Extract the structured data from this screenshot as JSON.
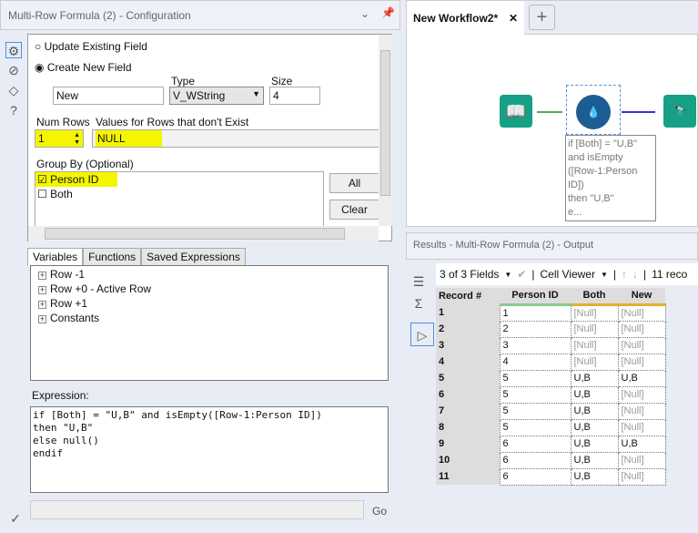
{
  "config": {
    "title": "Multi-Row Formula (2) - Configuration",
    "update_label": "Update Existing Field",
    "create_label": "Create New  Field",
    "type_label": "Type",
    "size_label": "Size",
    "field_name": "New",
    "type_value": "V_WString",
    "size_value": "4",
    "num_rows_label": "Num Rows",
    "num_rows_value": "1",
    "nonexist_label": "Values for Rows that don't Exist",
    "nonexist_value": "NULL",
    "group_label": "Group By (Optional)",
    "group_items": [
      {
        "label": "Person ID",
        "checked": true
      },
      {
        "label": "Both",
        "checked": false
      }
    ],
    "all_btn": "All",
    "clear_btn": "Clear",
    "tabs": [
      "Variables",
      "Functions",
      "Saved Expressions"
    ],
    "tree": [
      "Row -1",
      "Row +0 - Active Row",
      "Row +1",
      "Constants"
    ],
    "expression_label": "Expression:",
    "expression": "if [Both] = \"U,B\" and isEmpty([Row-1:Person ID])\nthen \"U,B\"\nelse null()\nendif",
    "go_label": "Go"
  },
  "workflow": {
    "tab": "New Workflow2*",
    "annotation": "if [Both] = \"U,B\"\nand isEmpty\n([Row-1:Person\nID])\nthen \"U,B\"\ne..."
  },
  "results": {
    "title": "Results - Multi-Row Formula (2) - Output",
    "fields": "3 of 3 Fields",
    "viewer": "Cell Viewer",
    "count": "11 reco",
    "headers": [
      "Record #",
      "Person ID",
      "Both",
      "New"
    ],
    "rows": [
      [
        "1",
        "1",
        "[Null]",
        "[Null]"
      ],
      [
        "2",
        "2",
        "[Null]",
        "[Null]"
      ],
      [
        "3",
        "3",
        "[Null]",
        "[Null]"
      ],
      [
        "4",
        "4",
        "[Null]",
        "[Null]"
      ],
      [
        "5",
        "5",
        "U,B",
        "U,B"
      ],
      [
        "6",
        "5",
        "U,B",
        "[Null]"
      ],
      [
        "7",
        "5",
        "U,B",
        "[Null]"
      ],
      [
        "8",
        "5",
        "U,B",
        "[Null]"
      ],
      [
        "9",
        "6",
        "U,B",
        "U,B"
      ],
      [
        "10",
        "6",
        "U,B",
        "[Null]"
      ],
      [
        "11",
        "6",
        "U,B",
        "[Null]"
      ]
    ]
  }
}
